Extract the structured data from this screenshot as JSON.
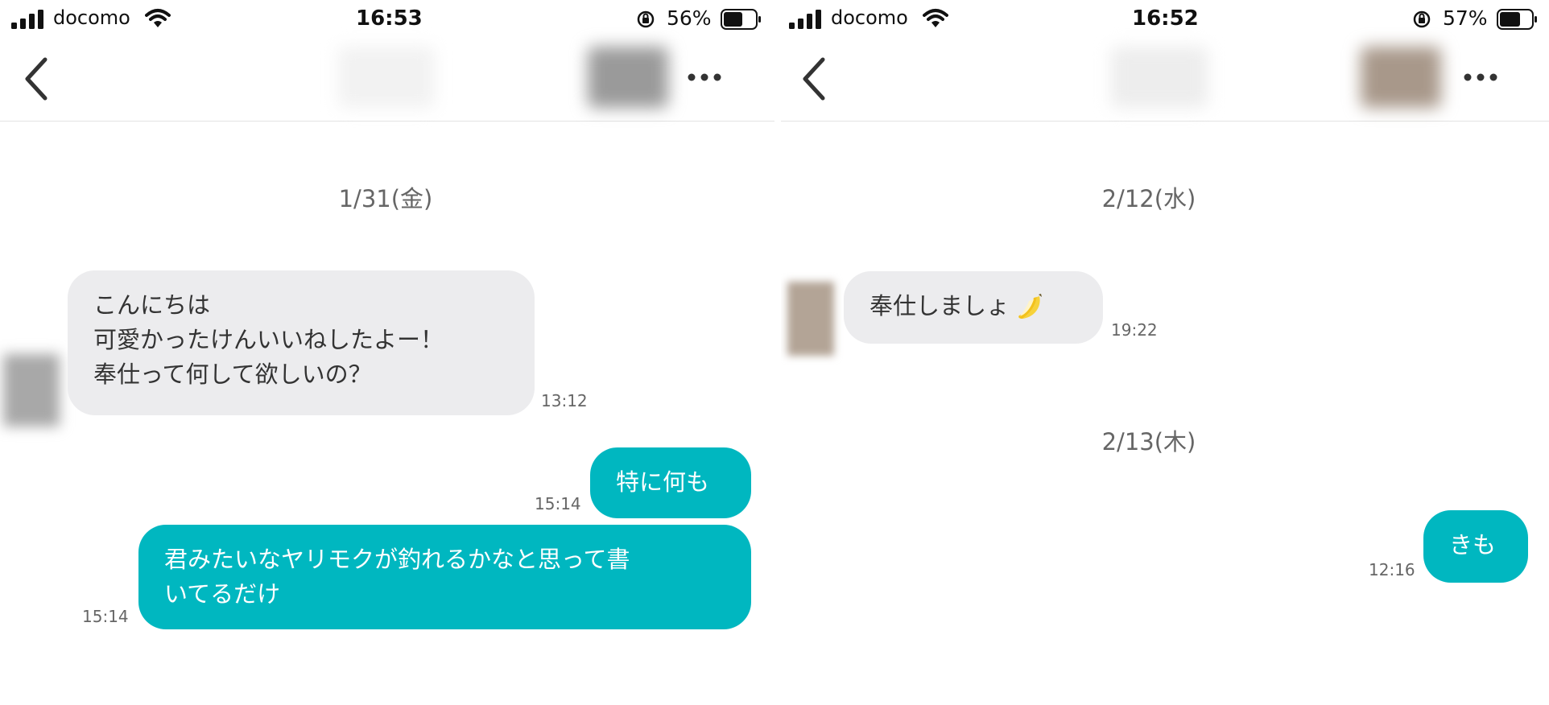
{
  "left": {
    "status": {
      "carrier": "docomo",
      "time": "16:53",
      "battery": "56%"
    },
    "date": "1/31(金)",
    "incoming": {
      "lines": [
        "こんにちは",
        "可愛かったけんいいねしたよー！",
        "奉仕って何して欲しいの？"
      ],
      "time": "13:12"
    },
    "outgoing": [
      {
        "lines": [
          "特に何も"
        ],
        "time": "15:14"
      },
      {
        "lines": [
          "君みたいなヤリモクが釣れるかなと思って書",
          "いてるだけ"
        ],
        "time": "15:14"
      }
    ]
  },
  "right": {
    "status": {
      "carrier": "docomo",
      "time": "16:52",
      "battery": "57%"
    },
    "date1": "2/12(水)",
    "incoming": {
      "text": "奉仕しましょ",
      "emoji": "banana",
      "time": "19:22"
    },
    "date2": "2/13(木)",
    "outgoing": {
      "text": "きも",
      "time": "12:16"
    }
  },
  "colors": {
    "outgoing_bubble": "#00b7c0",
    "incoming_bubble": "#ececee"
  },
  "icons": [
    "signal-icon",
    "wifi-icon",
    "orientation-lock-icon",
    "battery-icon",
    "back-chevron-icon",
    "more-options-icon",
    "banana-emoji"
  ]
}
